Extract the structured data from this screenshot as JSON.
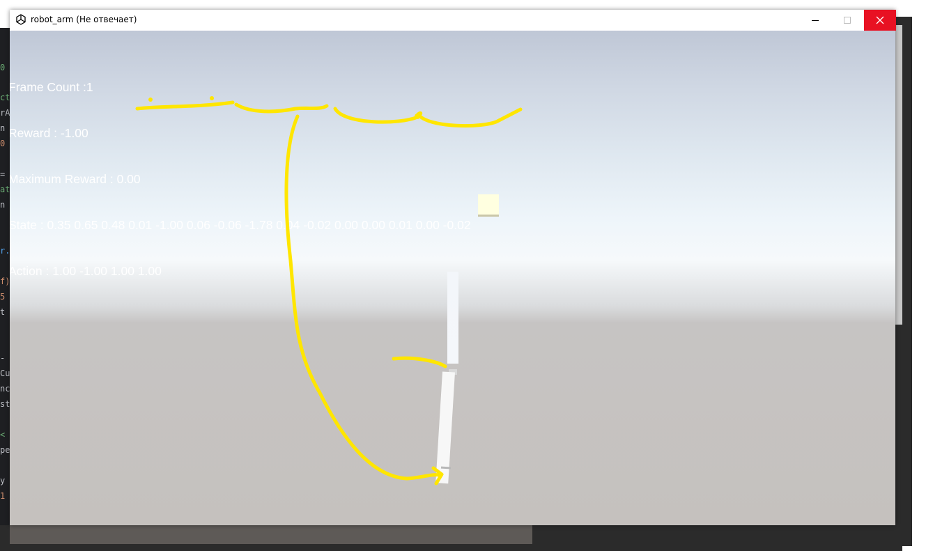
{
  "window": {
    "title": "robot_arm (Не отвечает)"
  },
  "hud": {
    "frame_count": "Frame Count :1",
    "reward": "Reward : -1.00",
    "max_reward": "Maximum Reward : 0.00",
    "state": "State : 0.35 0.65 0.48 0.01 -1.00 0.06 -0.06 -1.78 0.04 -0.02 0.00 0.00 0.01 0.00 -0.02",
    "action": "Action : 1.00 -1.00 1.00 1.00"
  },
  "background_code": [
    {
      "text": "0",
      "color": "#6aab73"
    },
    {
      "text": "ct",
      "color": "#6aab73"
    },
    {
      "text": "rA",
      "color": "#bcbec4"
    },
    {
      "text": "n",
      "color": "#bcbec4"
    },
    {
      "text": "0",
      "color": "#cf8e6d"
    },
    {
      "text": "=",
      "color": "#bcbec4"
    },
    {
      "text": "at",
      "color": "#6aab73"
    },
    {
      "text": "n",
      "color": "#bcbec4"
    },
    {
      "text": "r.",
      "color": "#56a8f5"
    },
    {
      "text": "f)",
      "color": "#cf8e6d"
    },
    {
      "text": "5",
      "color": "#cf8e6d"
    },
    {
      "text": "t",
      "color": "#bcbec4"
    },
    {
      "text": "-",
      "color": "#bcbec4"
    },
    {
      "text": "Cu",
      "color": "#bcbec4"
    },
    {
      "text": "nc",
      "color": "#bcbec4"
    },
    {
      "text": "st",
      "color": "#bcbec4"
    },
    {
      "text": "<",
      "color": "#6aab73"
    },
    {
      "text": "pe",
      "color": "#bcbec4"
    },
    {
      "text": "y",
      "color": "#bcbec4"
    },
    {
      "text": "1",
      "color": "#cf8e6d"
    }
  ],
  "colors": {
    "annotation": "#ffe600",
    "close_button": "#e81123"
  }
}
